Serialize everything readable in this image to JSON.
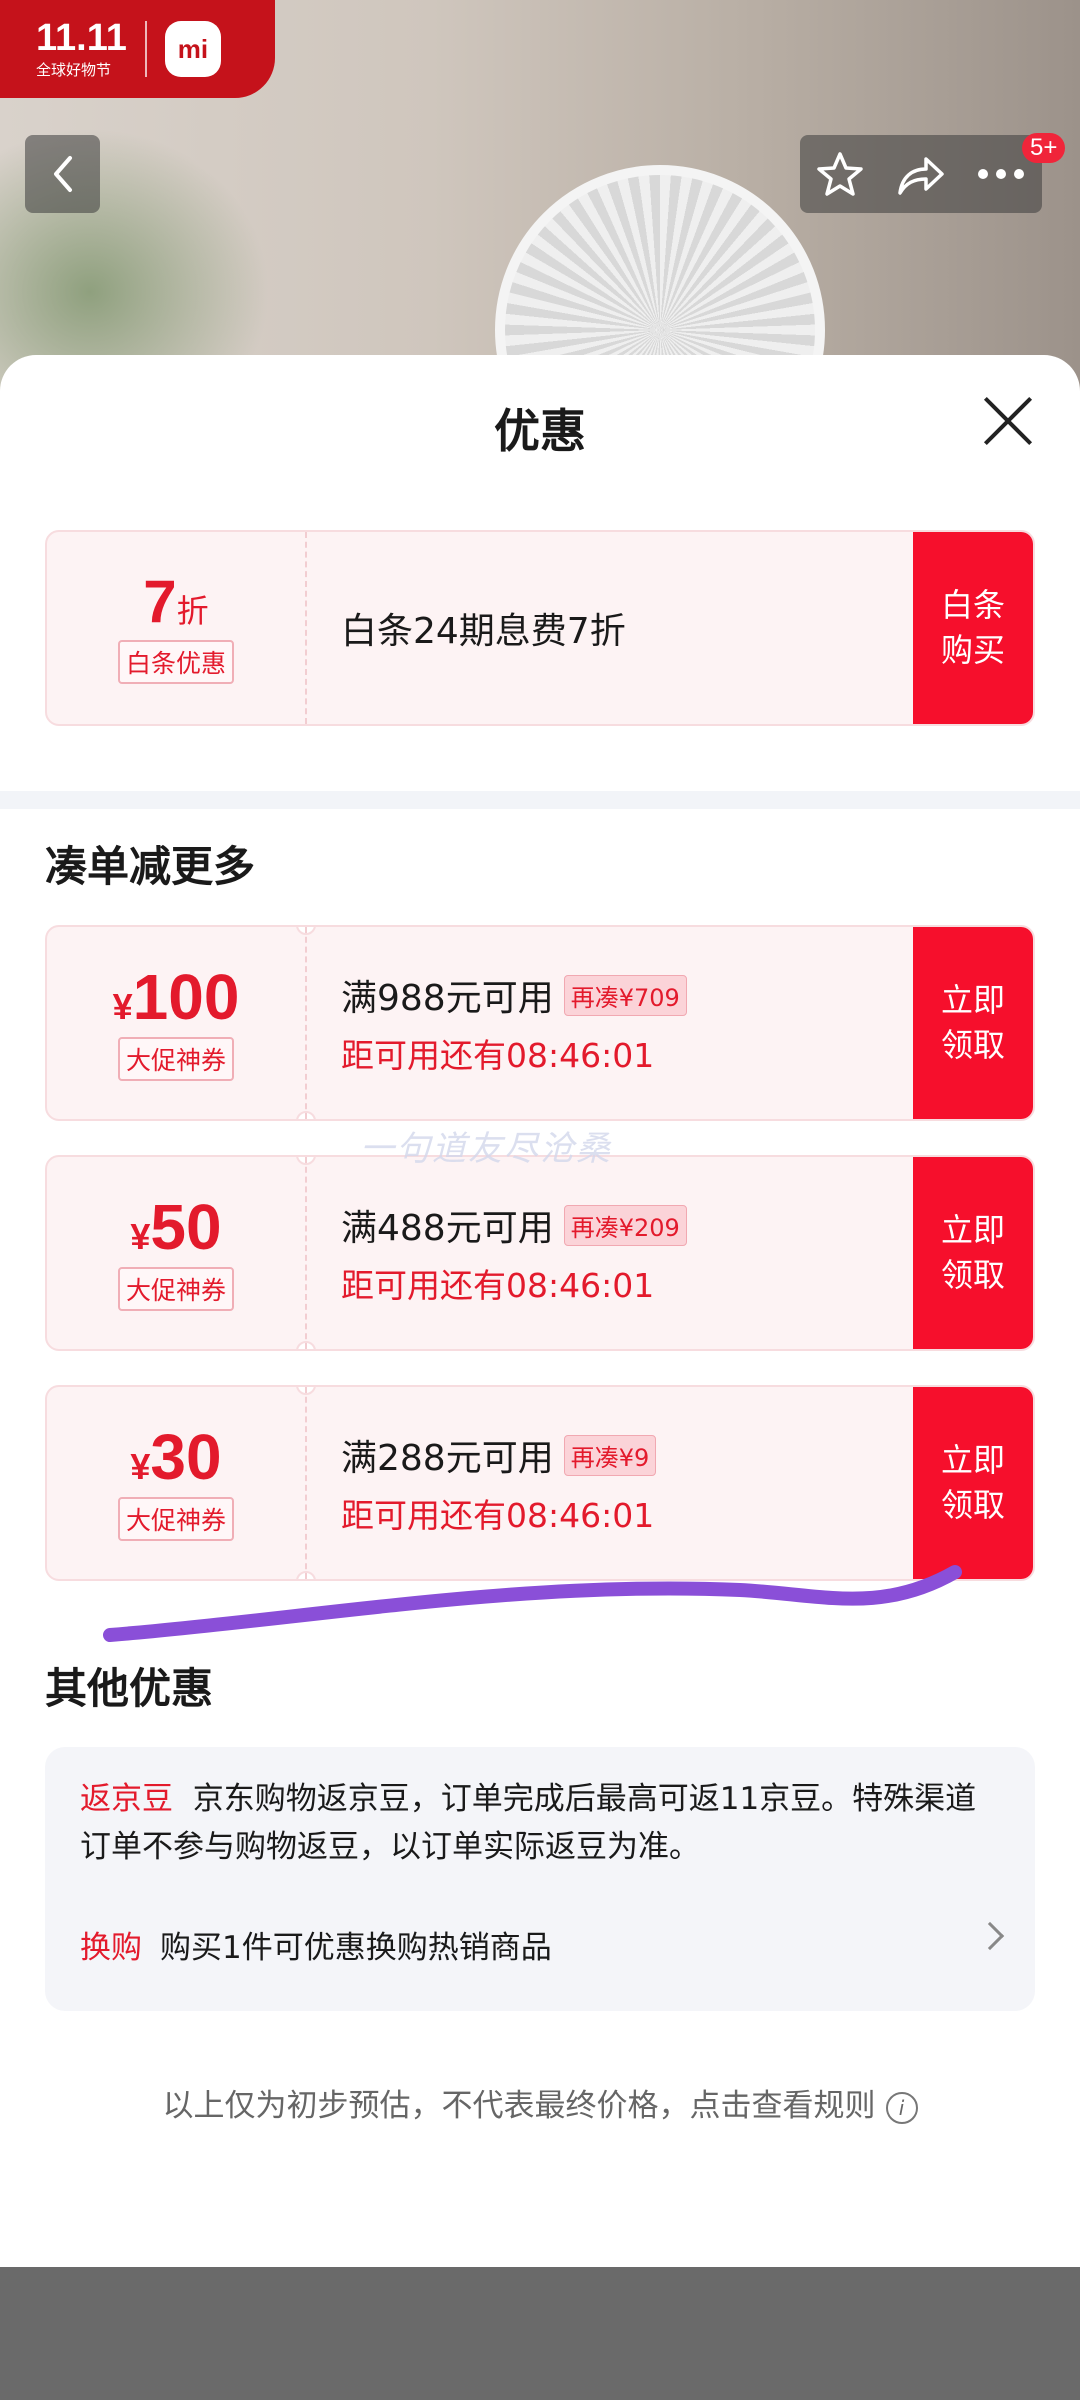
{
  "header": {
    "badge_line1": "11.11",
    "badge_line2": "全球好物节",
    "brand_logo": "mi",
    "notification_count": "5+",
    "icons": [
      "back-icon",
      "star-icon",
      "share-icon",
      "more-icon"
    ]
  },
  "sheet": {
    "title": "优惠",
    "baitiao": {
      "amount": "7",
      "unit": "折",
      "tag": "白条优惠",
      "desc": "白条24期息费7折",
      "button": [
        "白条",
        "购买"
      ]
    },
    "coudan_title": "凑单减更多",
    "coupons": [
      {
        "currency": "¥",
        "amount": "100",
        "tag": "大促神券",
        "condition": "满988元可用",
        "extra": "再凑¥709",
        "timer": "距可用还有08:46:01",
        "button": [
          "立即",
          "领取"
        ]
      },
      {
        "currency": "¥",
        "amount": "50",
        "tag": "大促神券",
        "condition": "满488元可用",
        "extra": "再凑¥209",
        "timer": "距可用还有08:46:01",
        "button": [
          "立即",
          "领取"
        ]
      },
      {
        "currency": "¥",
        "amount": "30",
        "tag": "大促神券",
        "condition": "满288元可用",
        "extra": "再凑¥9",
        "timer": "距可用还有08:46:01",
        "button": [
          "立即",
          "领取"
        ]
      }
    ],
    "watermark": "一句道友尽沧桑",
    "other_title": "其他优惠",
    "other": {
      "bean_label": "返京豆",
      "bean_text": "京东购物返京豆，订单完成后最高可返11京豆。特殊渠道订单不参与购物返豆，以订单实际返豆为准。",
      "swap_label": "换购",
      "swap_text": "购买1件可优惠换购热销商品"
    },
    "disclaimer": "以上仅为初步预估，不代表最终价格，点击查看规则"
  },
  "colors": {
    "accent": "#f60f2c",
    "text_red": "#e31a2c",
    "scribble": "#8a4fd8"
  }
}
